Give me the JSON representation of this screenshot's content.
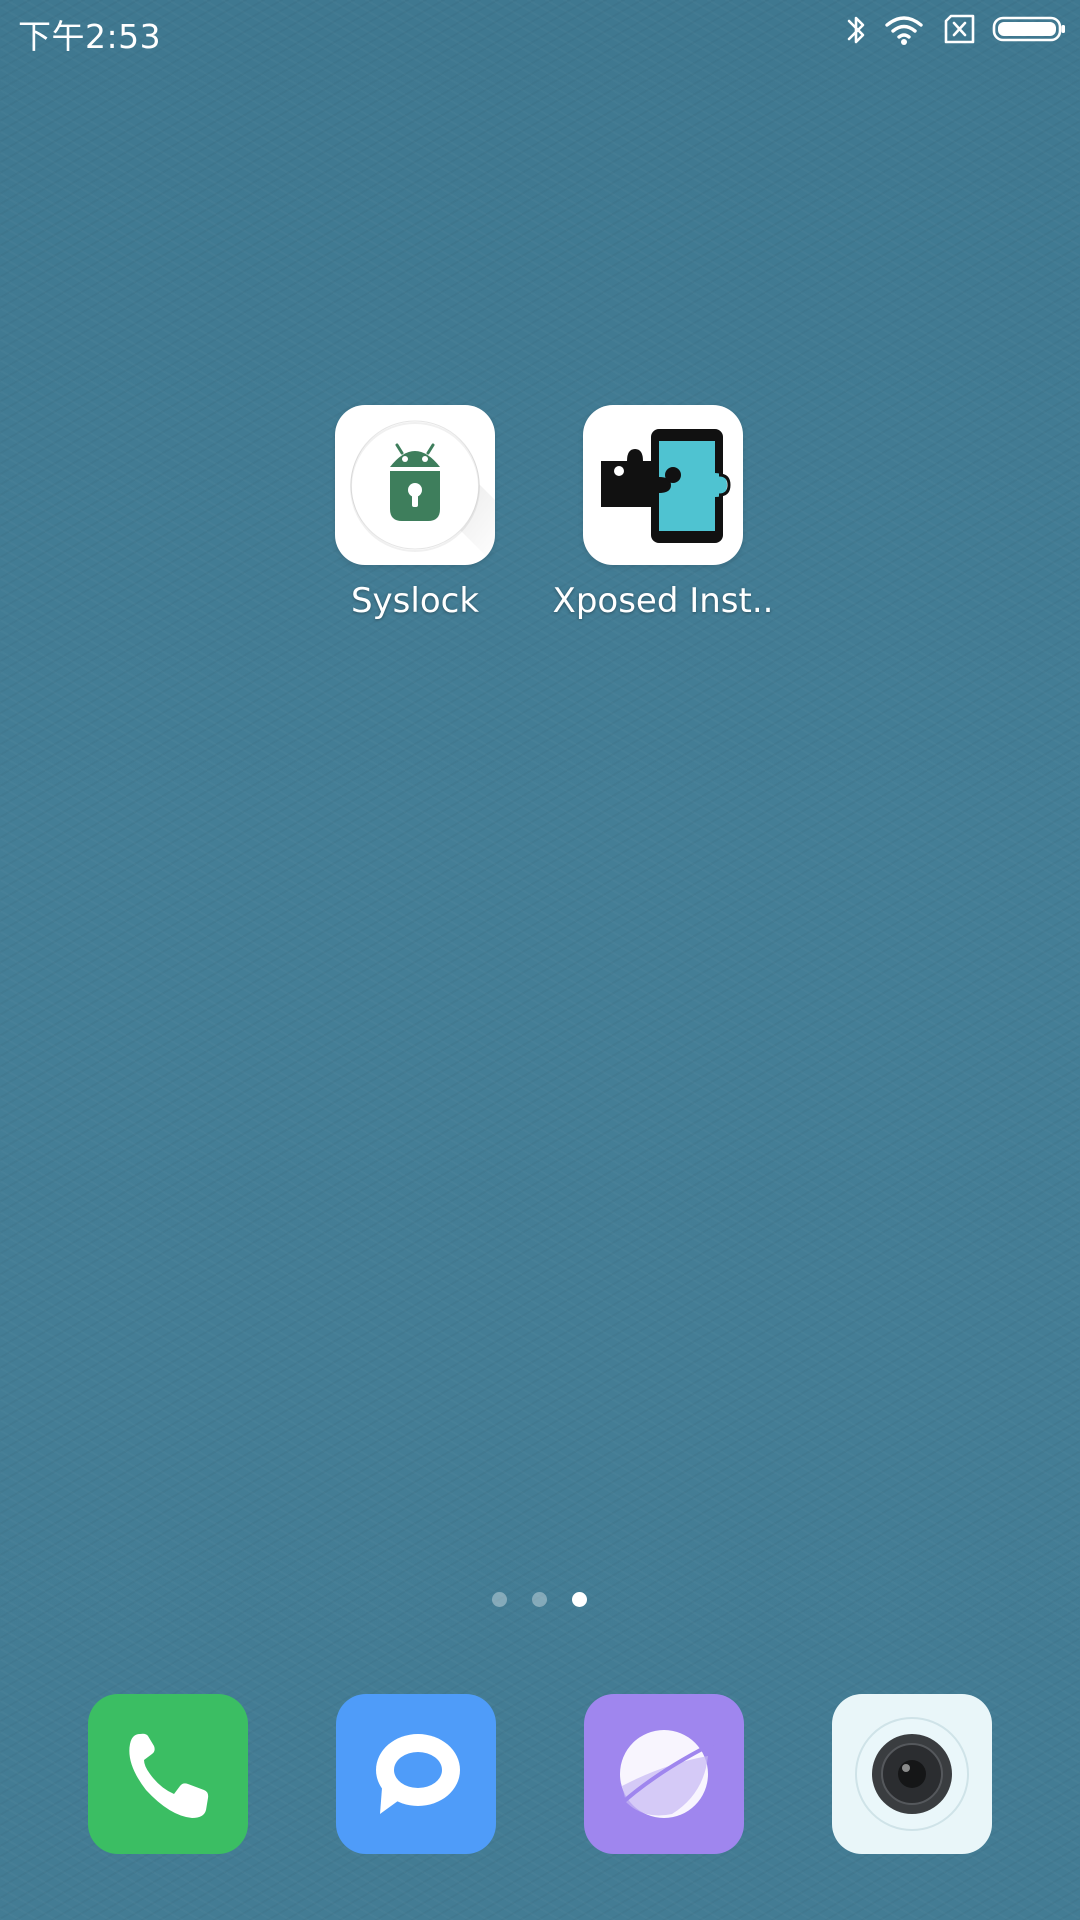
{
  "status_bar": {
    "time": "下午2:53",
    "icons": [
      "bluetooth-icon",
      "wifi-icon",
      "no-sim-icon",
      "battery-icon"
    ]
  },
  "home_apps": [
    {
      "label": "Syslock",
      "icon": "syslock-android-lock-icon"
    },
    {
      "label": "Xposed Inst..",
      "icon": "xposed-puzzle-phone-icon"
    }
  ],
  "page_indicator": {
    "pages": 3,
    "current": 3
  },
  "dock": [
    {
      "name": "phone",
      "icon": "phone-icon",
      "color": "#3bbe63"
    },
    {
      "name": "messages",
      "icon": "message-bubble-icon",
      "color": "#4f9cf9"
    },
    {
      "name": "browser",
      "icon": "planet-icon",
      "color": "#9f86ee"
    },
    {
      "name": "camera",
      "icon": "camera-lens-icon",
      "color": "#e9f6f9"
    }
  ],
  "colors": {
    "wallpaper": "#437c94",
    "syslock_green": "#3e7e5c",
    "xposed_teal": "#4fc3d1"
  }
}
